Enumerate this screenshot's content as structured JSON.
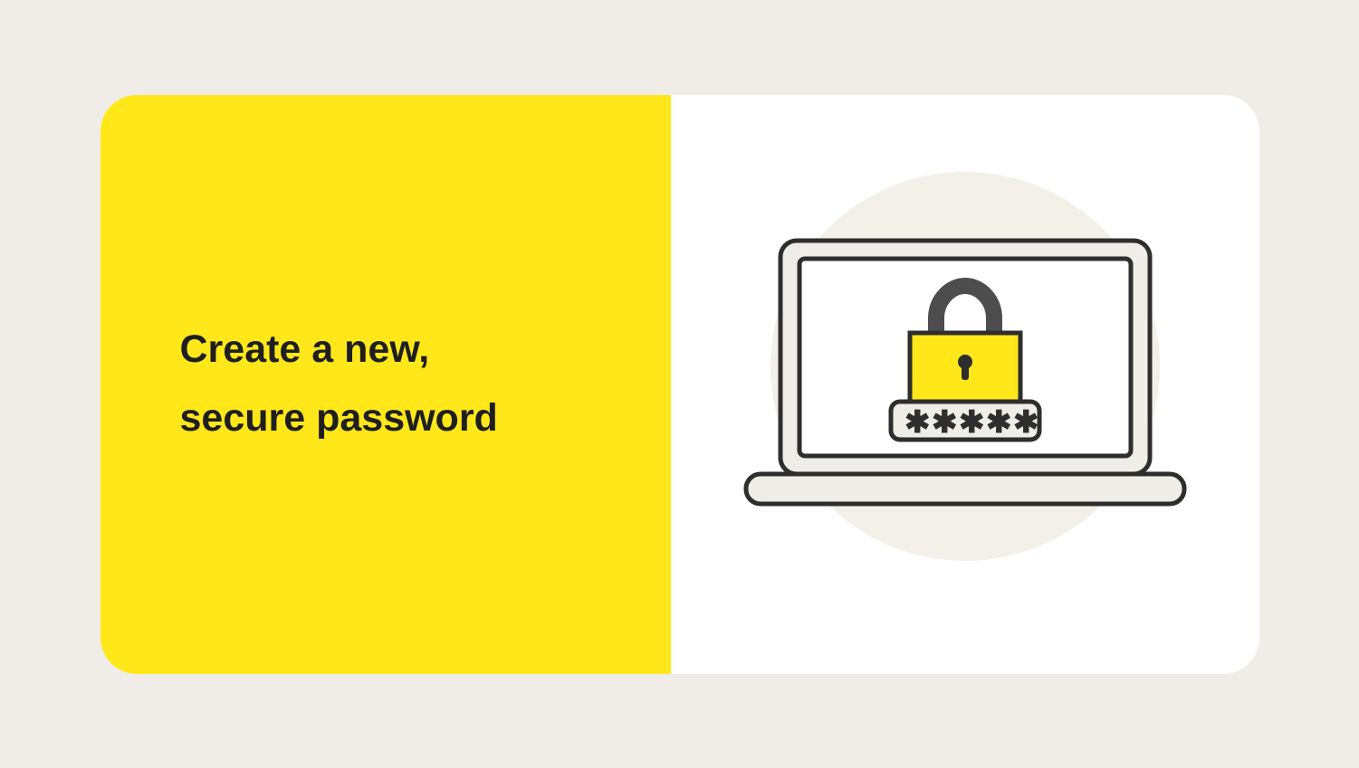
{
  "heading_line1": "Create a new,",
  "heading_line2": "secure password",
  "colors": {
    "background": "#f0ede8",
    "yellow": "#ffe71a",
    "dark": "#1f1f1f",
    "white": "#ffffff",
    "circle": "#f3f0ea",
    "laptop_fill": "#efede7",
    "stroke": "#2e2e2e",
    "shackle": "#4d4d4d"
  }
}
